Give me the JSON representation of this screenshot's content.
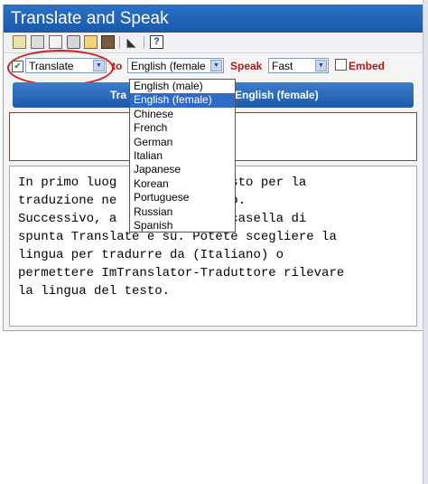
{
  "title": "Translate and Speak",
  "toolbar": {
    "icons": [
      "notepad-icon",
      "notes-icon",
      "clear-icon",
      "trash-icon",
      "dictionary-icon",
      "keyboard-icon",
      "speaker-icon",
      "help-icon"
    ]
  },
  "controls": {
    "translate_checked": true,
    "mode_select": "Translate",
    "to_label": "to",
    "voice_select": "English (female",
    "speak_label": "Speak",
    "speed_select": "Fast",
    "embed_label": "Embed",
    "embed_checked": false
  },
  "translate_bar": {
    "left_text": "Tra",
    "right_text": "English (female)"
  },
  "input_text": "In primo luog          il testo per la\ntraduzione ne           testo.\nSuccessivo, a         he la casella di\nspunta Translate è su. Potete scegliere la\nlingua per tradurre da (Italiano) o\npermettere ImTranslator-Traduttore rilevare\nla lingua del testo.",
  "dropdown": {
    "options": [
      "English (male)",
      "English (female)",
      "Chinese",
      "French",
      "German",
      "Italian",
      "Japanese",
      "Korean",
      "Portuguese",
      "Russian",
      "Spanish"
    ],
    "selected_index": 1
  },
  "colors": {
    "title_bar": "#1b58a8",
    "label_red": "#b21a1a",
    "highlight": "#316ac5",
    "annotation_oval": "#d21d1d"
  }
}
